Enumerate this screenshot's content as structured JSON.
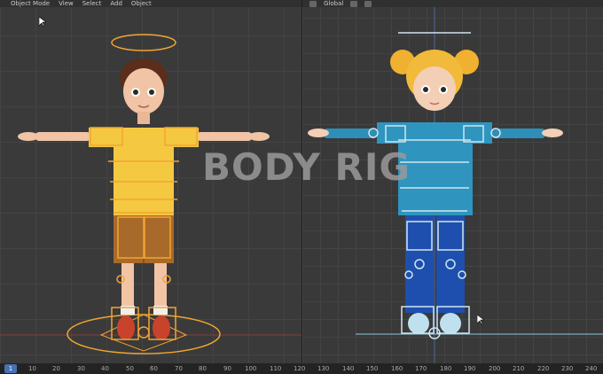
{
  "header": {
    "mode": "Object Mode",
    "menu": [
      "View",
      "Select",
      "Add",
      "Object"
    ],
    "orientation": "Global"
  },
  "overlay_title": "BODY RIG",
  "timeline": {
    "current_frame": "1",
    "ticks": [
      "10",
      "20",
      "30",
      "40",
      "50",
      "60",
      "70",
      "80",
      "90",
      "100",
      "110",
      "120",
      "130",
      "140",
      "150",
      "160",
      "170",
      "180",
      "190",
      "200",
      "210",
      "220",
      "230",
      "240"
    ]
  },
  "icons": {
    "cursor_left": "mouse-cursor-icon",
    "cursor_right": "mouse-cursor-icon"
  },
  "colors": {
    "rig_left": "#f2a531",
    "rig_right": "#cfe6ef",
    "accent": "#4772b3"
  }
}
